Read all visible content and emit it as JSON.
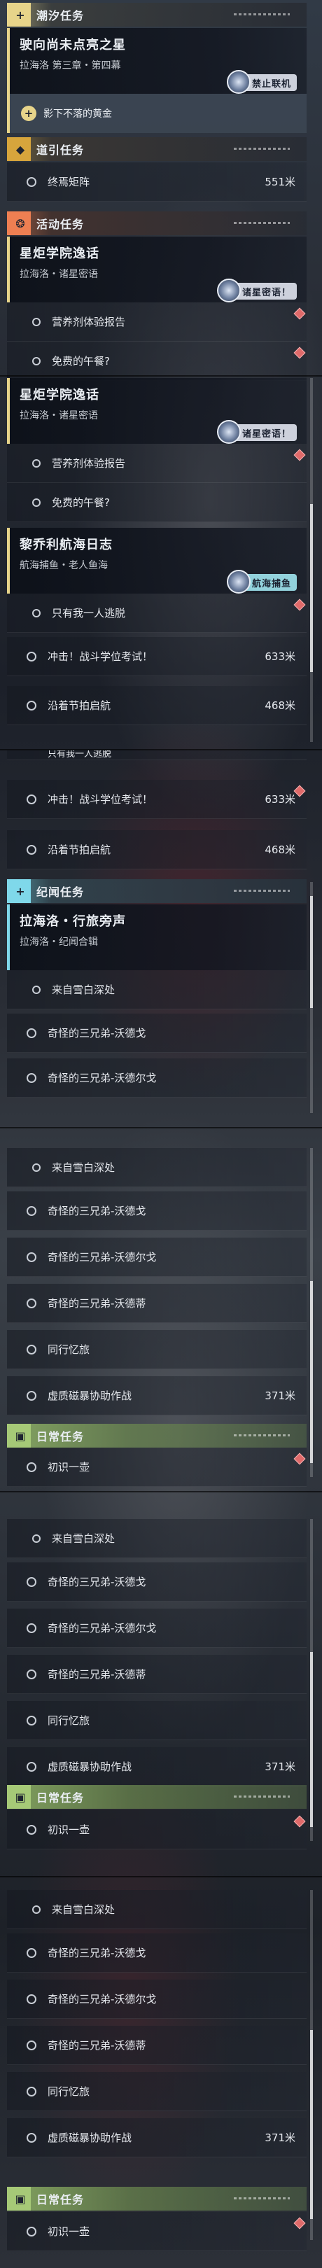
{
  "sections": {
    "tide": {
      "icon": "+",
      "title": "潮汐任务"
    },
    "guide": {
      "icon": "◆",
      "title": "道引任务"
    },
    "activity": {
      "icon": "❂",
      "title": "活动任务"
    },
    "lore": {
      "icon": "+",
      "title": "纪闻任务"
    },
    "daily": {
      "icon": "▣",
      "title": "日常任务"
    }
  },
  "tide_card": {
    "title": "驶向尚未点亮之星",
    "subtitle": "拉海洛 第三章・第四幕",
    "badge": "禁止联机"
  },
  "tide_hint": {
    "text": "影下不落的黄金"
  },
  "guide_row": {
    "text": "终焉矩阵",
    "dist": "551米"
  },
  "academy": {
    "title": "星炬学院逸话",
    "subtitle": "拉海洛・诸星密语",
    "badge": "诸星密语！"
  },
  "academy_rows": [
    "营养剂体验报告",
    "免费的午餐?"
  ],
  "voyage": {
    "title": "黎乔利航海日志",
    "subtitle": "航海捕鱼・老人鱼海",
    "badge": "航海捕鱼"
  },
  "voyage_rows": [
    {
      "text": "只有我一人逃脱",
      "dist": ""
    },
    {
      "text": "冲击！战斗学位考试！",
      "dist": "633米"
    },
    {
      "text": "沿着节拍启航",
      "dist": "468米"
    }
  ],
  "lore_card": {
    "title": "拉海洛・行旅旁声",
    "subtitle": "拉海洛・纪闻合辑"
  },
  "lore_rows": [
    {
      "text": "来自雪白深处",
      "dist": ""
    },
    {
      "text": "奇怪的三兄弟-沃德戈",
      "dist": ""
    },
    {
      "text": "奇怪的三兄弟-沃德尔戈",
      "dist": ""
    },
    {
      "text": "奇怪的三兄弟-沃德蒂",
      "dist": ""
    },
    {
      "text": "同行忆旅",
      "dist": ""
    },
    {
      "text": "虚质磁暴协助作战",
      "dist": "371米"
    }
  ],
  "daily_row": {
    "text": "初识一壶"
  },
  "partial": {
    "text": "只有我一人逃脱"
  }
}
